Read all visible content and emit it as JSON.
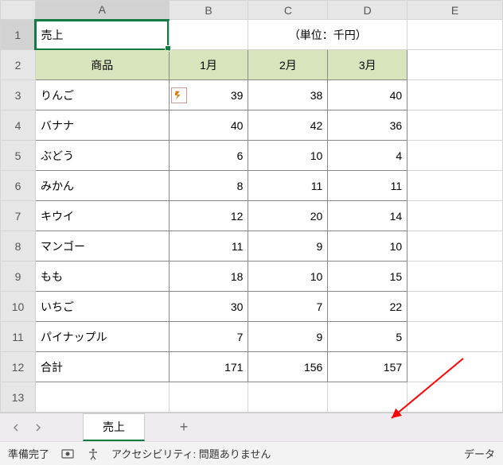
{
  "columns": [
    "A",
    "B",
    "C",
    "D",
    "E"
  ],
  "rows": [
    "1",
    "2",
    "3",
    "4",
    "5",
    "6",
    "7",
    "8",
    "9",
    "10",
    "11",
    "12",
    "13"
  ],
  "title_row": {
    "label": "売上",
    "unit": "（単位：千円）"
  },
  "headers": {
    "product": "商品",
    "m1": "1月",
    "m2": "2月",
    "m3": "3月"
  },
  "chart_data": {
    "type": "table",
    "title": "売上",
    "unit": "千円",
    "columns": [
      "商品",
      "1月",
      "2月",
      "3月"
    ],
    "rows": [
      {
        "product": "りんご",
        "m1": 39,
        "m2": 38,
        "m3": 40
      },
      {
        "product": "バナナ",
        "m1": 40,
        "m2": 42,
        "m3": 36
      },
      {
        "product": "ぶどう",
        "m1": 6,
        "m2": 10,
        "m3": 4
      },
      {
        "product": "みかん",
        "m1": 8,
        "m2": 11,
        "m3": 11
      },
      {
        "product": "キウイ",
        "m1": 12,
        "m2": 20,
        "m3": 14
      },
      {
        "product": "マンゴー",
        "m1": 11,
        "m2": 9,
        "m3": 10
      },
      {
        "product": "もも",
        "m1": 18,
        "m2": 10,
        "m3": 15
      },
      {
        "product": "いちご",
        "m1": 30,
        "m2": 7,
        "m3": 22
      },
      {
        "product": "パイナップル",
        "m1": 7,
        "m2": 9,
        "m3": 5
      }
    ],
    "totals": {
      "product": "合計",
      "m1": 171,
      "m2": 156,
      "m3": 157
    }
  },
  "sheet_tab": "売上",
  "status": {
    "ready": "準備完了",
    "accessibility": "アクセシビリティ: 問題ありません",
    "data": "データ"
  }
}
